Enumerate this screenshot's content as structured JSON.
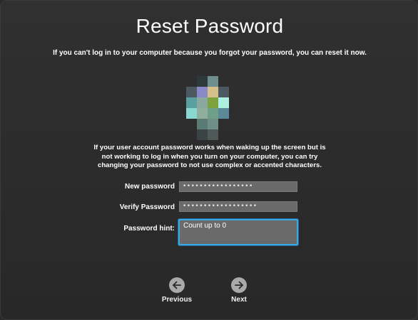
{
  "window": {
    "title": "Reset Password",
    "subtitle": "If you can't log in to your computer because you forgot your password, you can reset it now."
  },
  "avatar": {
    "icon": "user-avatar-pixelated",
    "colors": [
      "#2d3a3a",
      "#6f8f8e",
      "#5a8a9a",
      "#4d5960",
      "#5aa0a0",
      "#8a89c8",
      "#d6c089",
      "#8aa8a0",
      "#8ad6d0",
      "#6f8f86",
      "#7ea33e",
      "#aef0e0",
      "#3e4a4a",
      "#8fae9e",
      "#6f9f88",
      "#5a7a76",
      "#3a4444",
      "#505858",
      "#364040"
    ]
  },
  "notice": {
    "line1": "If your user account password works when waking up the screen but is",
    "line2": "not working to log in when you turn on your computer, you can try",
    "line3": "changing your password to not use complex or accented characters."
  },
  "form": {
    "new_password_label": "New password",
    "new_password_value": "•••••••••••••••••",
    "verify_password_label": "Verify Password",
    "verify_password_value": "••••••••••••••••••",
    "hint_label": "Password  hint:",
    "hint_value": "Count up to 0"
  },
  "nav": {
    "previous_label": "Previous",
    "previous_icon": "arrow-left-icon",
    "next_label": "Next",
    "next_icon": "arrow-right-icon"
  },
  "colors": {
    "background": "#2a2a2a",
    "field_bg": "#6a6a6a",
    "focus_ring": "#3aa7e3",
    "nav_button": "#a9a9a9"
  }
}
